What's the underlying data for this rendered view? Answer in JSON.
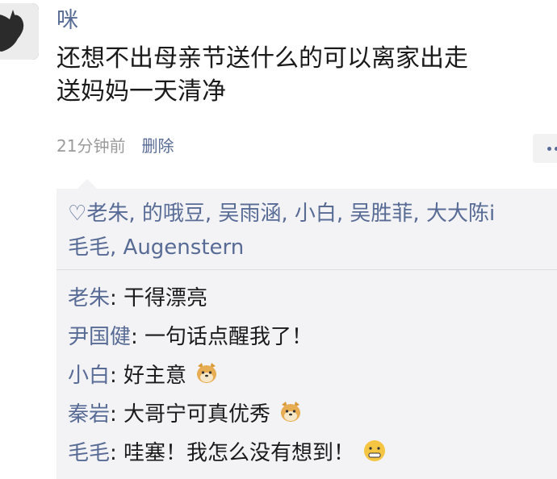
{
  "post": {
    "username": "咪",
    "text_line1": "还想不出母亲节送什么的可以离家出走",
    "text_line2": "送妈妈一天清净",
    "time": "21分钟前",
    "delete_label": "删除"
  },
  "likes": {
    "heart": "♡",
    "line1": "老朱, 的哦豆, 吴雨涵, 小白, 吴胜菲, 大大陈i",
    "line2": "毛毛, Augenstern"
  },
  "comments": [
    {
      "author": "老朱",
      "text": ": 干得漂亮",
      "emoji": null
    },
    {
      "author": "尹国健",
      "text": ": 一句话点醒我了！",
      "emoji": null
    },
    {
      "author": "小白",
      "text": ": 好主意",
      "emoji": "doge-emoji"
    },
    {
      "author": "秦岩",
      "text": ": 大哥宁可真优秀",
      "emoji": "doge-emoji"
    },
    {
      "author": "毛毛",
      "text": ": 哇塞！我怎么没有想到！",
      "emoji": "grimace-emoji"
    }
  ],
  "colors": {
    "link": "#576b95",
    "text": "#1a1a1a",
    "meta": "#9b9b9b",
    "panel": "#f3f3f5"
  }
}
